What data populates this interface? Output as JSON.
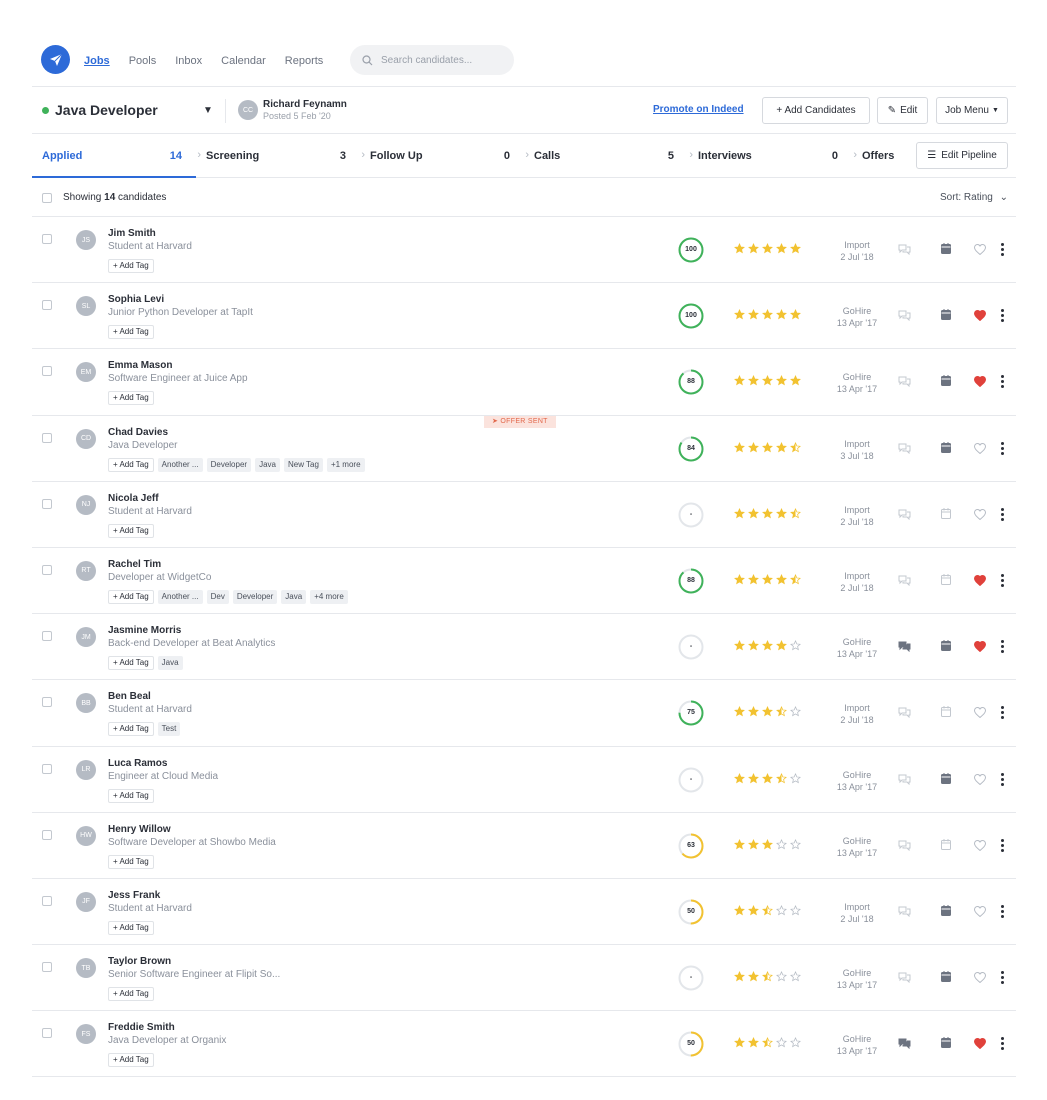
{
  "nav": {
    "items": [
      "Jobs",
      "Pools",
      "Inbox",
      "Calendar",
      "Reports"
    ],
    "active": 0,
    "search_placeholder": "Search candidates..."
  },
  "job": {
    "title": "Java Developer",
    "status_color": "#3fb25a",
    "owner_initials": "CC",
    "owner_name": "Richard Feynamn",
    "posted": "Posted 5 Feb '20",
    "promote_label": "Promote on Indeed",
    "add_label": "+ Add Candidates",
    "edit_label": "Edit",
    "menu_label": "Job Menu"
  },
  "stages": [
    {
      "label": "Applied",
      "count": "14"
    },
    {
      "label": "Screening",
      "count": "3"
    },
    {
      "label": "Follow Up",
      "count": "0"
    },
    {
      "label": "Calls",
      "count": "5"
    },
    {
      "label": "Interviews",
      "count": "0"
    },
    {
      "label": "Offers",
      "count": ""
    }
  ],
  "active_stage": 0,
  "edit_pipeline_label": "Edit Pipeline",
  "list": {
    "showing_prefix": "Showing",
    "showing_count": "14",
    "showing_suffix": "candidates",
    "sort_label": "Sort: Rating"
  },
  "add_tag_label": "+ Add Tag",
  "colors": {
    "accent": "#2d6ad8",
    "score_green": "#3fb25a",
    "score_yellow": "#f2c230",
    "star": "#f2c230",
    "heart": "#e0413b"
  },
  "candidates": [
    {
      "initials": "JS",
      "name": "Jim Smith",
      "role": "Student at Harvard",
      "tags": [],
      "score": "100",
      "score_pct": 100,
      "rating": 5,
      "source": "Import",
      "date": "2 Jul '18",
      "messages": false,
      "scheduled": true,
      "favorite": false,
      "badge": ""
    },
    {
      "initials": "SL",
      "name": "Sophia Levi",
      "role": "Junior Python Developer at TapIt",
      "tags": [],
      "score": "100",
      "score_pct": 100,
      "rating": 5,
      "source": "GoHire",
      "date": "13 Apr '17",
      "messages": false,
      "scheduled": true,
      "favorite": true,
      "badge": ""
    },
    {
      "initials": "EM",
      "name": "Emma Mason",
      "role": "Software Engineer at Juice App",
      "tags": [],
      "score": "88",
      "score_pct": 88,
      "rating": 5,
      "source": "GoHire",
      "date": "13 Apr '17",
      "messages": false,
      "scheduled": true,
      "favorite": true,
      "badge": ""
    },
    {
      "initials": "CD",
      "name": "Chad Davies",
      "role": "Java Developer",
      "tags": [
        "Another ...",
        "Developer",
        "Java",
        "New Tag",
        "+1 more"
      ],
      "score": "84",
      "score_pct": 84,
      "rating": 4.5,
      "source": "Import",
      "date": "3 Jul '18",
      "messages": false,
      "scheduled": true,
      "favorite": false,
      "badge": "OFFER SENT"
    },
    {
      "initials": "NJ",
      "name": "Nicola Jeff",
      "role": "Student at Harvard",
      "tags": [],
      "score": "-",
      "score_pct": 0,
      "rating": 4.5,
      "source": "Import",
      "date": "2 Jul '18",
      "messages": false,
      "scheduled": false,
      "favorite": false,
      "badge": ""
    },
    {
      "initials": "RT",
      "name": "Rachel Tim",
      "role": "Developer at WidgetCo",
      "tags": [
        "Another ...",
        "Dev",
        "Developer",
        "Java",
        "+4 more"
      ],
      "score": "88",
      "score_pct": 88,
      "rating": 4.5,
      "source": "Import",
      "date": "2 Jul '18",
      "messages": false,
      "scheduled": false,
      "favorite": true,
      "badge": ""
    },
    {
      "initials": "JM",
      "name": "Jasmine Morris",
      "role": "Back-end Developer at Beat Analytics",
      "tags": [
        "Java"
      ],
      "score": "-",
      "score_pct": 0,
      "rating": 4,
      "source": "GoHire",
      "date": "13 Apr '17",
      "messages": true,
      "scheduled": true,
      "favorite": true,
      "badge": ""
    },
    {
      "initials": "BB",
      "name": "Ben Beal",
      "role": "Student at Harvard",
      "tags": [
        "Test"
      ],
      "score": "75",
      "score_pct": 75,
      "rating": 3.5,
      "source": "Import",
      "date": "2 Jul '18",
      "messages": false,
      "scheduled": false,
      "favorite": false,
      "badge": ""
    },
    {
      "initials": "LR",
      "name": "Luca Ramos",
      "role": "Engineer at Cloud Media",
      "tags": [],
      "score": "-",
      "score_pct": 0,
      "rating": 3.5,
      "source": "GoHire",
      "date": "13 Apr '17",
      "messages": false,
      "scheduled": true,
      "favorite": false,
      "badge": ""
    },
    {
      "initials": "HW",
      "name": "Henry Willow",
      "role": "Software Developer at Showbo Media",
      "tags": [],
      "score": "63",
      "score_pct": 63,
      "rating": 3,
      "source": "GoHire",
      "date": "13 Apr '17",
      "messages": false,
      "scheduled": false,
      "favorite": false,
      "badge": ""
    },
    {
      "initials": "JF",
      "name": "Jess Frank",
      "role": "Student at Harvard",
      "tags": [],
      "score": "50",
      "score_pct": 50,
      "rating": 2.5,
      "source": "Import",
      "date": "2 Jul '18",
      "messages": false,
      "scheduled": true,
      "favorite": false,
      "badge": ""
    },
    {
      "initials": "TB",
      "name": "Taylor Brown",
      "role": "Senior Software Engineer at Flipit So...",
      "tags": [],
      "score": "-",
      "score_pct": 0,
      "rating": 2.5,
      "source": "GoHire",
      "date": "13 Apr '17",
      "messages": false,
      "scheduled": true,
      "favorite": false,
      "badge": ""
    },
    {
      "initials": "FS",
      "name": "Freddie Smith",
      "role": "Java Developer at Organix",
      "tags": [],
      "score": "50",
      "score_pct": 50,
      "rating": 2.5,
      "source": "GoHire",
      "date": "13 Apr '17",
      "messages": true,
      "scheduled": true,
      "favorite": true,
      "badge": ""
    }
  ]
}
